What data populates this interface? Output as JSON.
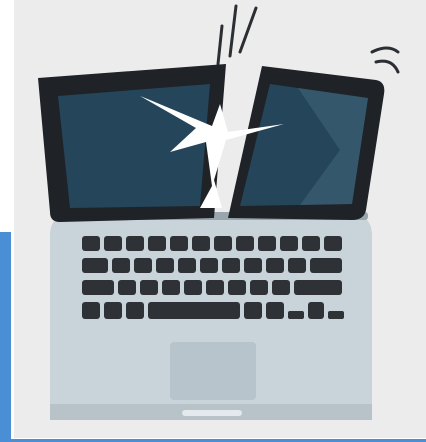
{
  "illustration": {
    "subject": "broken-laptop",
    "colors": {
      "background": "#ececec",
      "accent": "#4a8fd6",
      "bezel": "#1f2226",
      "screen": "#24455a",
      "body": "#c9d3da",
      "keys": "#2e3136",
      "crack": "#ffffff"
    }
  }
}
